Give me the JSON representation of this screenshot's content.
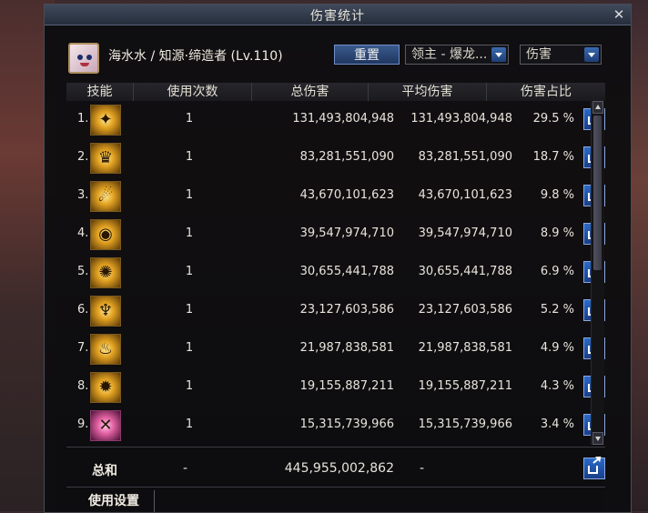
{
  "window": {
    "title": "伤害统计"
  },
  "character": {
    "name": "海水水 / 知源·缔造者 (Lv.110)"
  },
  "controls": {
    "reset_label": "重置",
    "target_select": "领主 - 爆龙...",
    "metric_select": "伤害"
  },
  "table": {
    "headers": [
      "技能",
      "使用次数",
      "总伤害",
      "平均伤害",
      "伤害占比"
    ],
    "rows": [
      {
        "index": "1.",
        "count": "1",
        "total": "131,493,804,948",
        "avg": "131,493,804,948",
        "pct": "29.5 %",
        "icon": "skill-icon-1"
      },
      {
        "index": "2.",
        "count": "1",
        "total": "83,281,551,090",
        "avg": "83,281,551,090",
        "pct": "18.7 %",
        "icon": "skill-icon-2"
      },
      {
        "index": "3.",
        "count": "1",
        "total": "43,670,101,623",
        "avg": "43,670,101,623",
        "pct": "9.8 %",
        "icon": "skill-icon-3"
      },
      {
        "index": "4.",
        "count": "1",
        "total": "39,547,974,710",
        "avg": "39,547,974,710",
        "pct": "8.9 %",
        "icon": "skill-icon-4"
      },
      {
        "index": "5.",
        "count": "1",
        "total": "30,655,441,788",
        "avg": "30,655,441,788",
        "pct": "6.9 %",
        "icon": "skill-icon-5"
      },
      {
        "index": "6.",
        "count": "1",
        "total": "23,127,603,586",
        "avg": "23,127,603,586",
        "pct": "5.2 %",
        "icon": "skill-icon-6"
      },
      {
        "index": "7.",
        "count": "1",
        "total": "21,987,838,581",
        "avg": "21,987,838,581",
        "pct": "4.9 %",
        "icon": "skill-icon-7"
      },
      {
        "index": "8.",
        "count": "1",
        "total": "19,155,887,211",
        "avg": "19,155,887,211",
        "pct": "4.3 %",
        "icon": "skill-icon-8"
      },
      {
        "index": "9.",
        "count": "1",
        "total": "15,315,739,966",
        "avg": "15,315,739,966",
        "pct": "3.4 %",
        "icon": "skill-icon-9"
      }
    ]
  },
  "summary": {
    "label": "总和",
    "count": "-",
    "total": "445,955,002,862",
    "avg": "-"
  },
  "tabs": {
    "usage_settings": "使用设置"
  }
}
